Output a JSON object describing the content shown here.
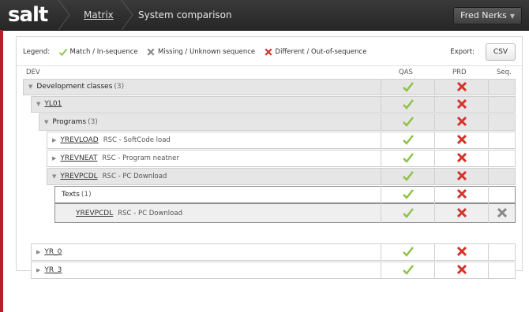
{
  "app": {
    "logo": "salt"
  },
  "breadcrumb": {
    "item1": "Matrix",
    "item2": "System comparison"
  },
  "user": {
    "name": "Fred Nerks"
  },
  "legend": {
    "title": "Legend:",
    "match": "Match / In-sequence",
    "missing": "Missing / Unknown sequence",
    "different": "Different / Out-of-sequence",
    "export_label": "Export:",
    "csv_label": "CSV"
  },
  "columns": {
    "dev": "DEV",
    "qas": "QAS",
    "prd": "PRD",
    "seq": "Seq."
  },
  "rows": {
    "devclasses": {
      "label": "Development classes",
      "count": "(3)"
    },
    "yl01": {
      "label": "YL01"
    },
    "programs": {
      "label": "Programs",
      "count": "(3)"
    },
    "yrevload": {
      "label": "YREVLOAD",
      "desc": "RSC - SoftCode load"
    },
    "yrevneat": {
      "label": "YREVNEAT",
      "desc": "RSC - Program neatner"
    },
    "yrevpcdl": {
      "label": "YREVPCDL",
      "desc": "RSC - PC Download"
    },
    "texts": {
      "label": "Texts",
      "count": "(1)"
    },
    "yrevpcdl_text": {
      "label": "YREVPCDL",
      "desc": "RSC - PC Download"
    },
    "yr0": {
      "label": "YR_0"
    },
    "yr3": {
      "label": "YR_3"
    }
  },
  "status_colors": {
    "match": "#8ec24a",
    "different": "#d6322b",
    "missing": "#888888"
  }
}
